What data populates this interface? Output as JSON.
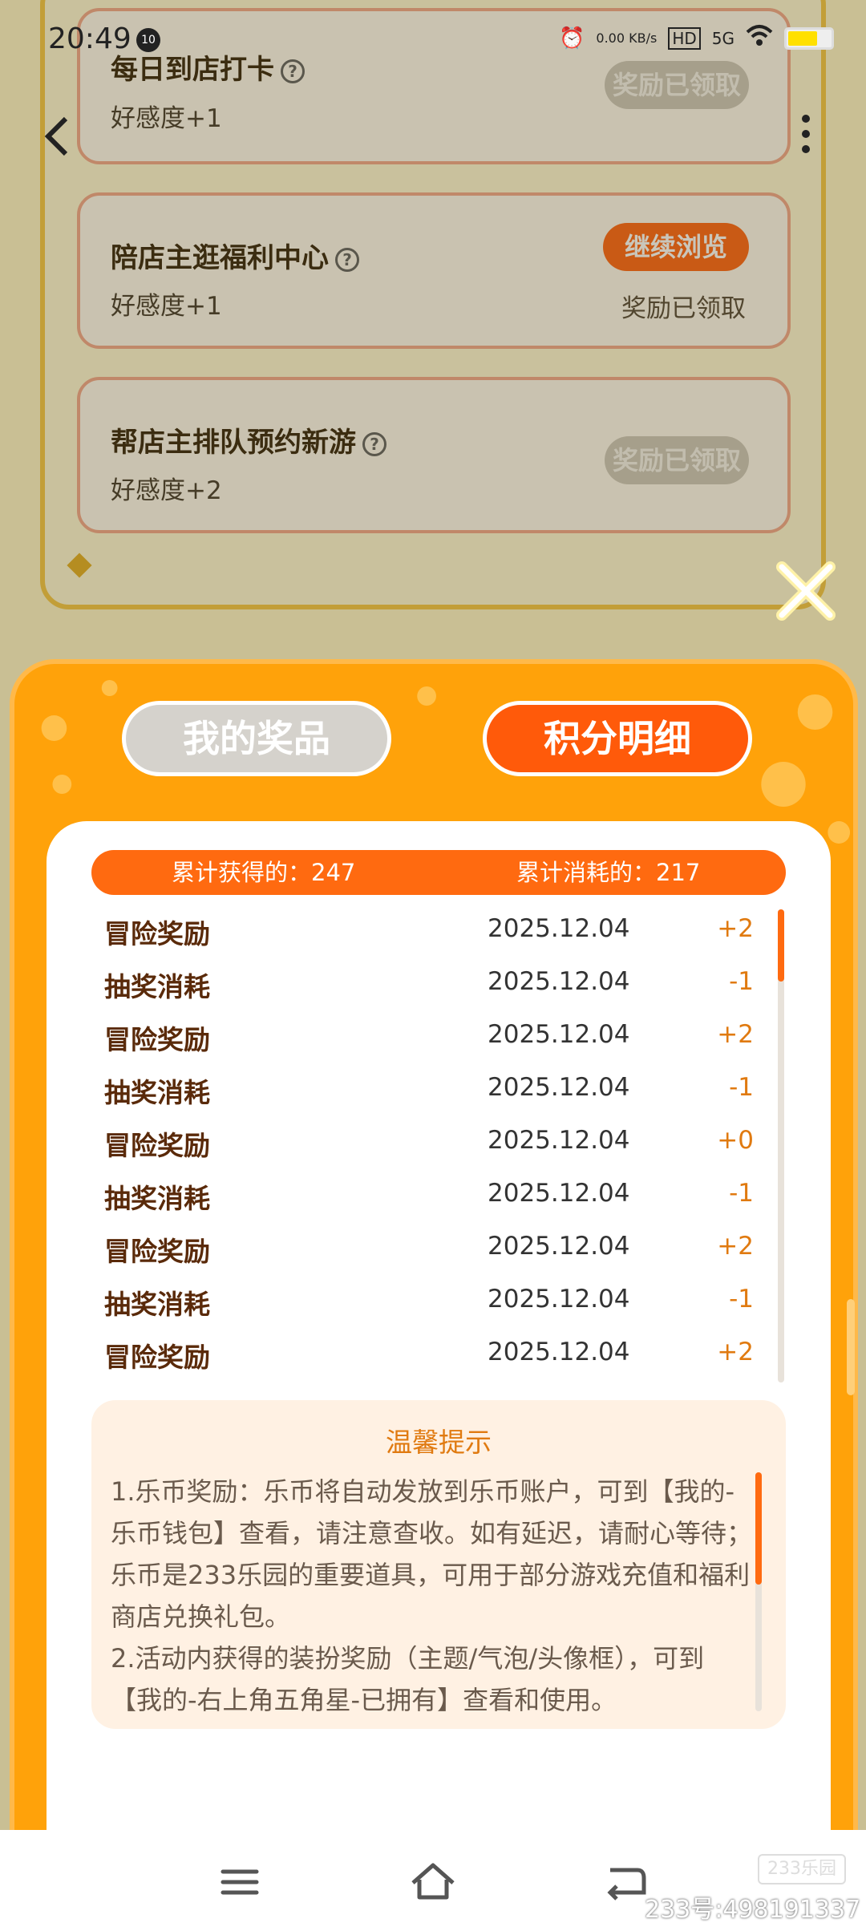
{
  "status_bar": {
    "time": "20:49",
    "notif_badge": "10",
    "net_speed": "0.00 KB/s",
    "hd": "HD",
    "signal": "5G"
  },
  "background_tasks": [
    {
      "title": "每日到店打卡",
      "reward": "好感度+1",
      "button": "奖励已领取",
      "button_state": "claimed"
    },
    {
      "title": "陪店主逛福利中心",
      "reward": "好感度+1",
      "button": "继续浏览",
      "button_state": "active",
      "note": "奖励已领取"
    },
    {
      "title": "帮店主排队预约新游",
      "reward": "好感度+2",
      "button": "奖励已领取",
      "button_state": "claimed"
    }
  ],
  "modal": {
    "tabs": [
      {
        "label": "我的奖品",
        "active": false
      },
      {
        "label": "积分明细",
        "active": true
      }
    ],
    "summary": {
      "earned_label": "累计获得的：247",
      "spent_label": "累计消耗的：217"
    },
    "records": [
      {
        "type": "冒险奖励",
        "date": "2025.12.04",
        "delta": "+2"
      },
      {
        "type": "抽奖消耗",
        "date": "2025.12.04",
        "delta": "-1"
      },
      {
        "type": "冒险奖励",
        "date": "2025.12.04",
        "delta": "+2"
      },
      {
        "type": "抽奖消耗",
        "date": "2025.12.04",
        "delta": "-1"
      },
      {
        "type": "冒险奖励",
        "date": "2025.12.04",
        "delta": "+0"
      },
      {
        "type": "抽奖消耗",
        "date": "2025.12.04",
        "delta": "-1"
      },
      {
        "type": "冒险奖励",
        "date": "2025.12.04",
        "delta": "+2"
      },
      {
        "type": "抽奖消耗",
        "date": "2025.12.04",
        "delta": "-1"
      },
      {
        "type": "冒险奖励",
        "date": "2025.12.04",
        "delta": "+2"
      }
    ],
    "tips": {
      "title": "温馨提示",
      "lines": [
        "1.乐币奖励：乐币将自动发放到乐币账户，可到【我的-乐币钱包】查看，请注意查收。如有延迟，请耐心等待；乐币是233乐园的重要道具，可用于部分游戏充值和福利商店兑换礼包。",
        "2.活动内获得的装扮奖励（主题/气泡/头像框），可到【我的-右上角五角星-已拥有】查看和使用。"
      ]
    }
  },
  "watermark": {
    "logo": "233乐园",
    "text": "233号:498191337"
  },
  "colors": {
    "modal_bg": "#ffa20a",
    "accent": "#ff6a10",
    "reward_text": "#e07a10",
    "record_type": "#5a2a0a"
  }
}
